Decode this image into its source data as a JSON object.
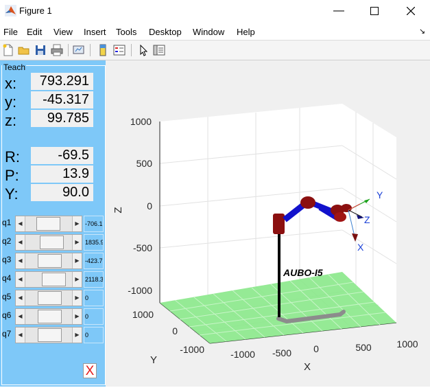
{
  "window": {
    "title": "Figure 1"
  },
  "menu": [
    "File",
    "Edit",
    "View",
    "Insert",
    "Tools",
    "Desktop",
    "Window",
    "Help"
  ],
  "toolbar_icons": [
    "new-figure-icon",
    "open-icon",
    "save-icon",
    "print-icon",
    "link-plot-icon",
    "colorbar-icon",
    "legend-icon",
    "pointer-icon",
    "property-editor-icon"
  ],
  "teach": {
    "title": "Teach",
    "pos": [
      {
        "label": "x:",
        "value": "793.291"
      },
      {
        "label": "y:",
        "value": "-45.317"
      },
      {
        "label": "z:",
        "value": "99.785"
      }
    ],
    "rot": [
      {
        "label": "R:",
        "value": "-69.5"
      },
      {
        "label": "P:",
        "value": "13.9"
      },
      {
        "label": "Y:",
        "value": "90.0"
      }
    ],
    "joints": [
      {
        "label": "q1",
        "value": "-706.1",
        "level": 0.45
      },
      {
        "label": "q2",
        "value": "1835.9",
        "level": 0.6
      },
      {
        "label": "q3",
        "value": "-423.7",
        "level": 0.52
      },
      {
        "label": "q4",
        "value": "2118.3",
        "level": 0.68
      },
      {
        "label": "q5",
        "value": "0",
        "level": 0.5
      },
      {
        "label": "q6",
        "value": "0",
        "level": 0.5
      },
      {
        "label": "q7",
        "value": "0",
        "level": 0.5
      }
    ],
    "close_label": "X"
  },
  "plot": {
    "robot_label": "AUBO-I5",
    "z_axis_label": "Z",
    "x_axis_label": "X",
    "y_axis_label": "Y",
    "z_ticks": [
      "1000",
      "500",
      "0",
      "-500",
      "-1000"
    ],
    "x_ticks": [
      "-1000",
      "-500",
      "0",
      "500",
      "1000"
    ],
    "y_ticks": [
      "1000",
      "0",
      "-1000"
    ],
    "frame_labels": {
      "x": "X",
      "y": "Y",
      "z": "Z"
    },
    "colors": {
      "link": "#1212cc",
      "joint": "#8b1010",
      "floor": "#7ee07e",
      "path": "#8c8c8c"
    }
  }
}
